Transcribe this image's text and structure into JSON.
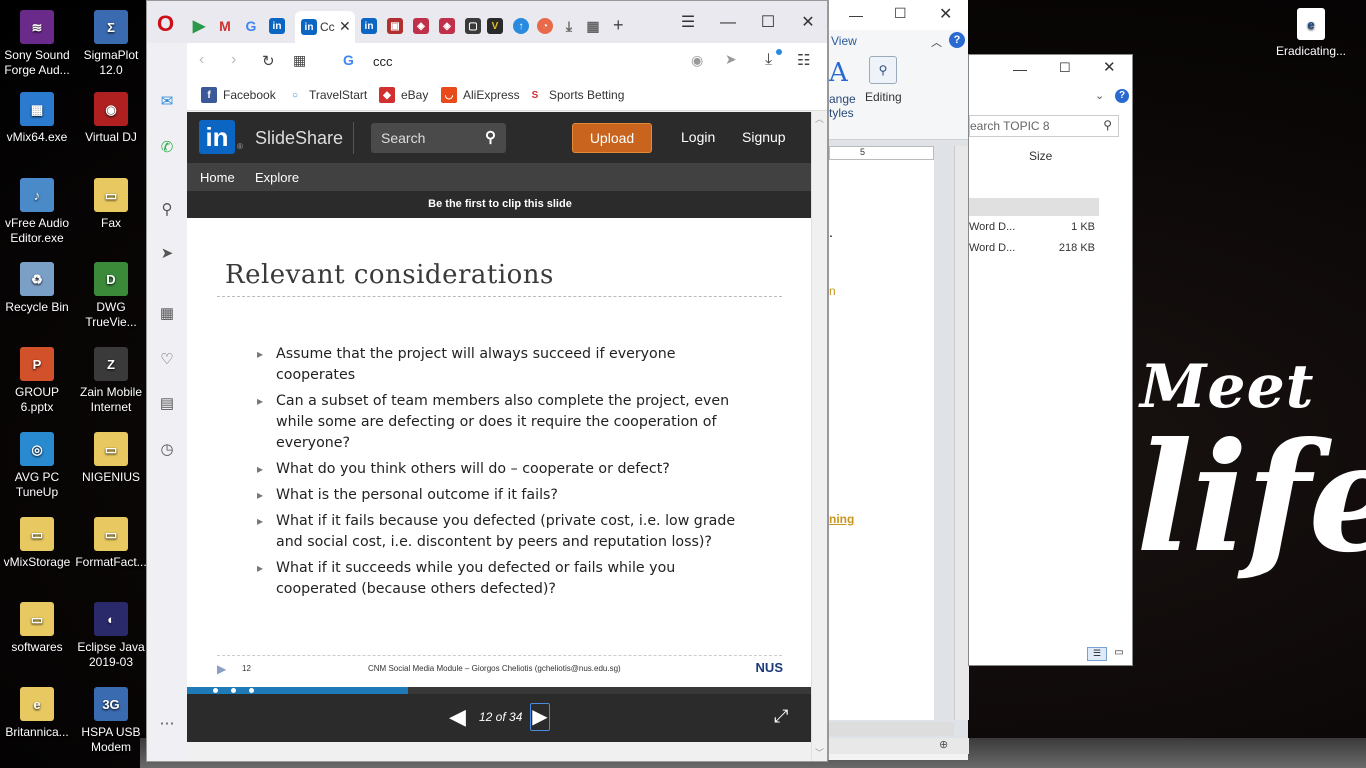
{
  "desktop": {
    "icons_left": [
      {
        "label": "Sony Sound Forge Aud...",
        "color": "#6a2a8a",
        "glyph": "≋"
      },
      {
        "label": "vMix64.exe",
        "color": "#2a7ad0",
        "glyph": "▦"
      },
      {
        "label": "vFree Audio Editor.exe",
        "color": "#4a8ac8",
        "glyph": "♪"
      },
      {
        "label": "Recycle Bin",
        "color": "#7aa0c8",
        "glyph": "♻"
      },
      {
        "label": "GROUP 6.pptx",
        "color": "#d2502a",
        "glyph": "P"
      },
      {
        "label": "AVG PC TuneUp",
        "color": "#2a8ad0",
        "glyph": "◎"
      },
      {
        "label": "vMixStorage",
        "color": "#e8c860",
        "glyph": "▭"
      },
      {
        "label": "softwares",
        "color": "#e8c860",
        "glyph": "▭"
      },
      {
        "label": "Britannica...",
        "color": "#e8c860",
        "glyph": "e"
      }
    ],
    "icons_right": [
      {
        "label": "SigmaPlot 12.0",
        "color": "#3a6ab0",
        "glyph": "Σ"
      },
      {
        "label": "Virtual DJ",
        "color": "#b02020",
        "glyph": "◉"
      },
      {
        "label": "Fax",
        "color": "#e8c860",
        "glyph": "▭"
      },
      {
        "label": "DWG TrueVie...",
        "color": "#3a8a3a",
        "glyph": "D"
      },
      {
        "label": "Zain Mobile Internet",
        "color": "#3a3a3a",
        "glyph": "Z"
      },
      {
        "label": "NIGENIUS",
        "color": "#e8c860",
        "glyph": "▭"
      },
      {
        "label": "FormatFact...",
        "color": "#e8c860",
        "glyph": "▭"
      },
      {
        "label": "Eclipse Java 2019-03",
        "color": "#2a2a6a",
        "glyph": "◐"
      },
      {
        "label": "HSPA USB Modem",
        "color": "#3a6ab0",
        "glyph": "3G"
      }
    ],
    "top_right_icon": {
      "label": "Eradicating...",
      "glyph": "e"
    },
    "wallpaper": {
      "line1": "Meet",
      "line2": "life"
    }
  },
  "word_window": {
    "view_tab": "View",
    "arrange_label": "ange",
    "styles_label": "tyles",
    "editing_label": "Editing",
    "ruler_mark": "5",
    "period": ".",
    "n_char": "n",
    "ning_link": "ning"
  },
  "explorer_window": {
    "search_placeholder": "earch TOPIC 8",
    "size_header": "Size",
    "rows": [
      {
        "name": "Word D...",
        "size": "1 KB"
      },
      {
        "name": "Word D...",
        "size": "218 KB"
      }
    ]
  },
  "browser": {
    "active_tab_label": "Cc",
    "new_tab": "+",
    "address": "ccc",
    "bookmarks": [
      {
        "label": "Facebook",
        "color": "#3b5998",
        "glyph": "f"
      },
      {
        "label": "TravelStart",
        "color": "#ffffff",
        "glyph": "○"
      },
      {
        "label": "eBay",
        "color": "#d23030",
        "glyph": "◆"
      },
      {
        "label": "AliExpress",
        "color": "#e84a1a",
        "glyph": "◡"
      },
      {
        "label": "Sports Betting",
        "color": "#ffffff",
        "glyph": "S"
      }
    ],
    "accent": "#cc0f16"
  },
  "slideshare": {
    "logo_in": "in",
    "logo_text": "SlideShare",
    "search_label": "Search",
    "upload": "Upload",
    "login": "Login",
    "signup": "Signup",
    "nav": [
      "Home",
      "Explore"
    ],
    "clip_banner": "Be the first to clip this slide",
    "upload_color": "#c8641e"
  },
  "slide": {
    "title": "Relevant considerations",
    "bullets": [
      "Assume that the project will always succeed if everyone cooperates",
      "Can a subset of team members also complete the project, even while some are defecting or does it require the cooperation of everyone?",
      "What do you think others will do – cooperate or defect?",
      "What is the personal outcome if it fails?",
      "What if it fails because you defected (private cost, i.e. low grade and social cost, i.e. discontent by peers and reputation loss)?",
      "What if it succeeds while you defected or fails while you cooperated (because others defected)?"
    ],
    "footer_number": "12",
    "footer_text": "CNM Social Media Module – Giorgos Cheliotis (gcheliotis@nus.edu.sg)",
    "footer_logo": "NUS"
  },
  "player": {
    "page_indicator": "12 of 34",
    "progress_fraction": 0.353
  }
}
